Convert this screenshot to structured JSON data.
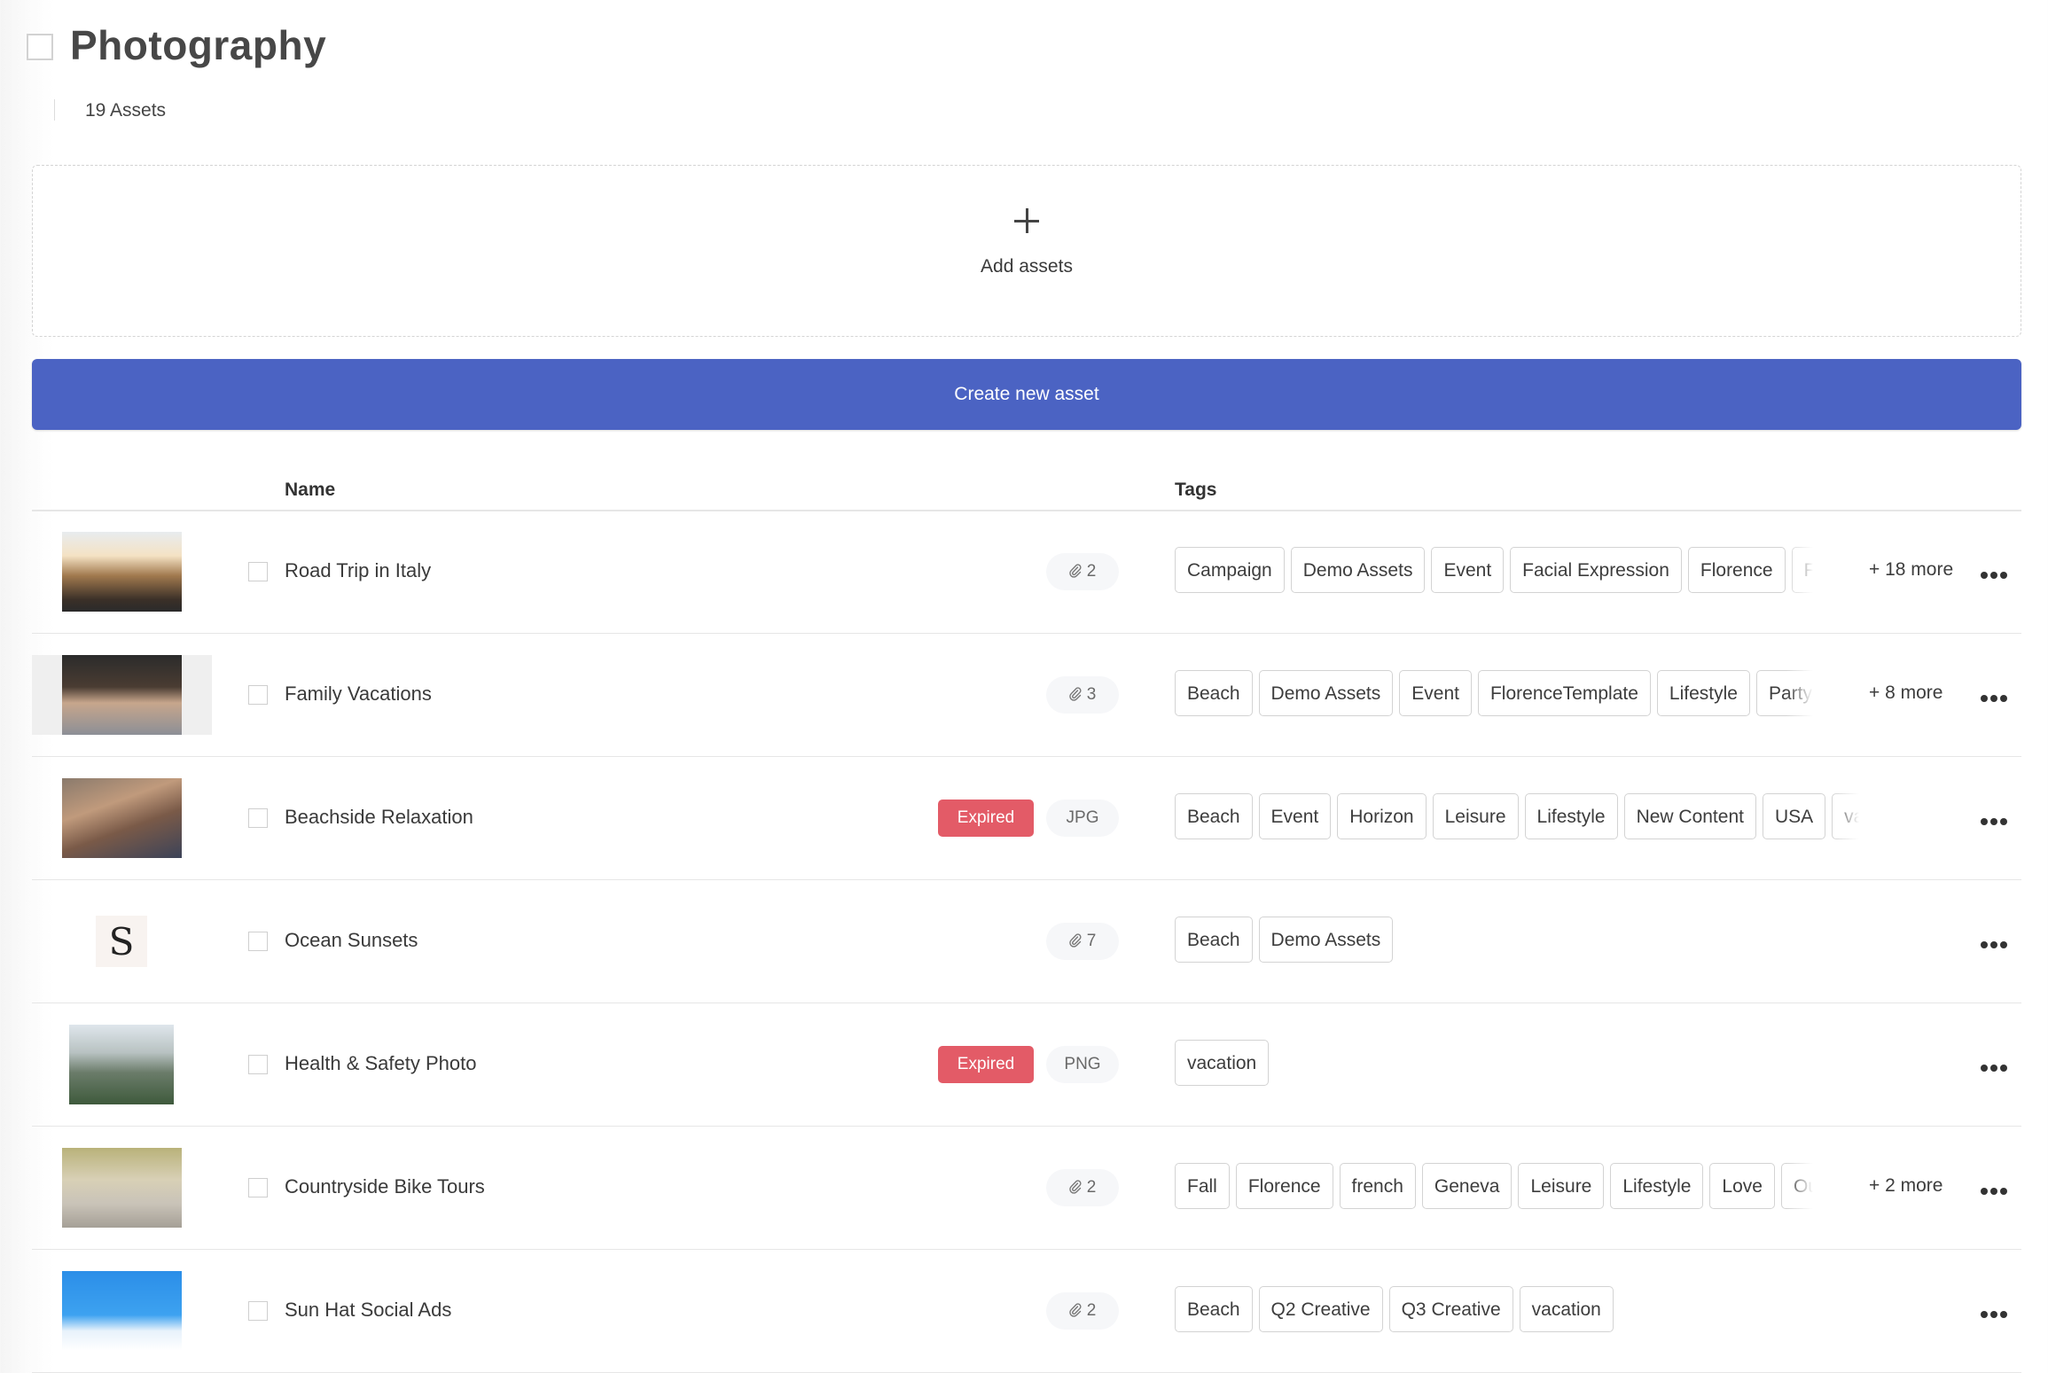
{
  "header": {
    "title": "Photography",
    "asset_count": "19 Assets"
  },
  "dropzone": {
    "icon": "plus-icon",
    "label": "Add assets"
  },
  "create_button": {
    "label": "Create new asset",
    "color": "#4b63c3"
  },
  "table": {
    "columns": {
      "name": "Name",
      "tags": "Tags"
    },
    "rows": [
      {
        "thumbnail": "road-trip-photo",
        "name": "Road Trip in Italy",
        "status": null,
        "pill": "2",
        "pill_icon": "paperclip-icon",
        "tags": [
          "Campaign",
          "Demo Assets",
          "Event",
          "Facial Expression",
          "Florence",
          "Food"
        ],
        "more": "+ 18 more"
      },
      {
        "thumbnail": "family-vacation-photo",
        "name": "Family Vacations",
        "status": null,
        "pill": "3",
        "pill_icon": "paperclip-icon",
        "tags": [
          "Beach",
          "Demo Assets",
          "Event",
          "FlorenceTemplate",
          "Lifestyle",
          "Party"
        ],
        "more": "+ 8 more"
      },
      {
        "thumbnail": "beachside-photo",
        "name": "Beachside Relaxation",
        "status": "Expired",
        "pill": "JPG",
        "pill_icon": null,
        "tags": [
          "Beach",
          "Event",
          "Horizon",
          "Leisure",
          "Lifestyle",
          "New Content",
          "USA",
          "vacation"
        ],
        "more": ""
      },
      {
        "thumbnail": "letter-s-logo",
        "name": "Ocean Sunsets",
        "status": null,
        "pill": "7",
        "pill_icon": "paperclip-icon",
        "tags": [
          "Beach",
          "Demo Assets"
        ],
        "more": ""
      },
      {
        "thumbnail": "mountain-lake-photo",
        "name": "Health & Safety Photo",
        "status": "Expired",
        "pill": "PNG",
        "pill_icon": null,
        "tags": [
          "vacation"
        ],
        "more": ""
      },
      {
        "thumbnail": "bike-tour-photo",
        "name": "Countryside Bike Tours",
        "status": null,
        "pill": "2",
        "pill_icon": "paperclip-icon",
        "tags": [
          "Fall",
          "Florence",
          "french",
          "Geneva",
          "Leisure",
          "Lifestyle",
          "Love",
          "Outdoor"
        ],
        "more": "+ 2 more"
      },
      {
        "thumbnail": "sun-hat-pool-photo",
        "name": "Sun Hat Social Ads",
        "status": null,
        "pill": "2",
        "pill_icon": "paperclip-icon",
        "tags": [
          "Beach",
          "Q2 Creative",
          "Q3 Creative",
          "vacation"
        ],
        "more": ""
      }
    ]
  },
  "colors": {
    "expired": "#e35b67",
    "pill_bg": "#f6f7f9",
    "tag_border": "#d3d3d3"
  }
}
